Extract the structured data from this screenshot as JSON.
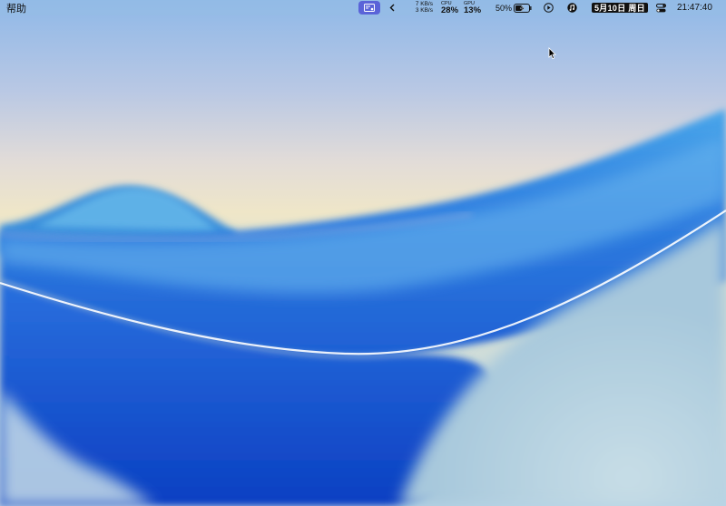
{
  "menubar": {
    "app_menu_label": "帮助",
    "status": {
      "network_up": "7 KB/s",
      "network_down": "3 KB/s",
      "cpu_label": "CPU",
      "cpu_value": "28%",
      "gpu_label": "GPU",
      "gpu_value": "13%",
      "battery_percent": "50%",
      "date": "5月10日 周日",
      "time": "21:47:40"
    },
    "icons": [
      "stats-app-icon",
      "chevron-left-icon",
      "battery-charging-icon",
      "play-circle-icon",
      "music-app-icon",
      "control-center-icon"
    ]
  },
  "colors": {
    "menubar_pill": "#5a63d8",
    "date_badge_bg": "#111111"
  }
}
